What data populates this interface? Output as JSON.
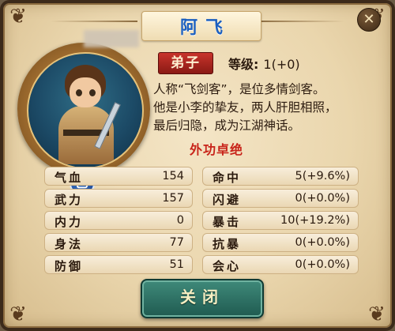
{
  "title": "阿飞",
  "role": "弟子",
  "level": {
    "label": "等级:",
    "value": "1(+0)"
  },
  "grade_icon_text": "乙",
  "description": [
    "人称“飞剑客”，是位多情剑客。",
    "他是小李的挚友，两人肝胆相照，",
    "最后归隐，成为江湖神话。"
  ],
  "skill": "外功卓绝",
  "stats_left": [
    {
      "name": "气血",
      "value": "154"
    },
    {
      "name": "武力",
      "value": "157"
    },
    {
      "name": "内力",
      "value": "0"
    },
    {
      "name": "身法",
      "value": "77"
    },
    {
      "name": "防御",
      "value": "51"
    }
  ],
  "stats_right": [
    {
      "name": "命中",
      "value": "5(+9.6%)"
    },
    {
      "name": "闪避",
      "value": "0(+0.0%)"
    },
    {
      "name": "暴击",
      "value": "10(+19.2%)"
    },
    {
      "name": "抗暴",
      "value": "0(+0.0%)"
    },
    {
      "name": "会心",
      "value": "0(+0.0%)"
    }
  ],
  "close_button": "关闭",
  "colors": {
    "title": "#1b5fbf",
    "skill": "#c8241a",
    "button": "#2f7465",
    "role_tag": "#b02a22"
  },
  "icons": {
    "close": "close-icon",
    "grade_badge": "grade-badge-icon"
  }
}
